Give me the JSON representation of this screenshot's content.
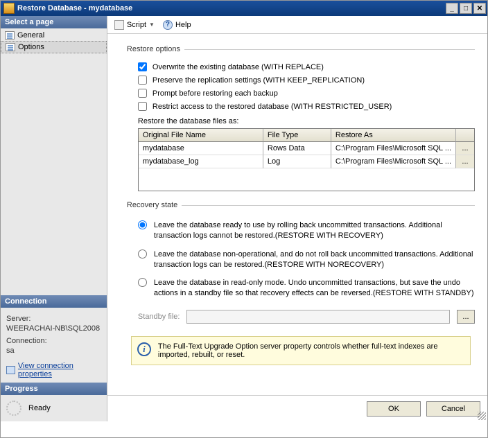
{
  "titlebar": {
    "title": "Restore Database - mydatabase"
  },
  "sidebar": {
    "select_page": "Select a page",
    "items": [
      {
        "label": "General"
      },
      {
        "label": "Options"
      }
    ],
    "connection_head": "Connection",
    "server_label": "Server:",
    "server_value": "WEERACHAI-NB\\SQL2008",
    "connection_label": "Connection:",
    "connection_value": "sa",
    "view_props": "View connection properties",
    "progress_head": "Progress",
    "progress_value": "Ready"
  },
  "toolbar": {
    "script": "Script",
    "help": "Help"
  },
  "restore_options": {
    "title": "Restore options",
    "overwrite": "Overwrite the existing database (WITH REPLACE)",
    "preserve": "Preserve the replication settings (WITH KEEP_REPLICATION)",
    "prompt": "Prompt before restoring each backup",
    "restrict": "Restrict access to the restored database (WITH RESTRICTED_USER)",
    "files_label": "Restore the database files as:",
    "grid": {
      "headers": {
        "c1": "Original File Name",
        "c2": "File Type",
        "c3": "Restore As"
      },
      "rows": [
        {
          "c1": "mydatabase",
          "c2": "Rows Data",
          "c3": "C:\\Program Files\\Microsoft SQL ..."
        },
        {
          "c1": "mydatabase_log",
          "c2": "Log",
          "c3": "C:\\Program Files\\Microsoft SQL ..."
        }
      ]
    }
  },
  "recovery": {
    "title": "Recovery state",
    "opt1": "Leave the database ready to use by rolling back uncommitted transactions. Additional transaction logs cannot be restored.(RESTORE WITH RECOVERY)",
    "opt2": "Leave the database non-operational, and do not roll back uncommitted transactions. Additional transaction logs can be restored.(RESTORE WITH NORECOVERY)",
    "opt3": "Leave the database in read-only mode. Undo uncommitted transactions, but save the undo actions in a standby file so that recovery effects can be reversed.(RESTORE WITH STANDBY)",
    "standby_label": "Standby file:"
  },
  "info": "The Full-Text Upgrade Option server property controls whether full-text indexes are imported, rebuilt, or reset.",
  "footer": {
    "ok": "OK",
    "cancel": "Cancel"
  }
}
